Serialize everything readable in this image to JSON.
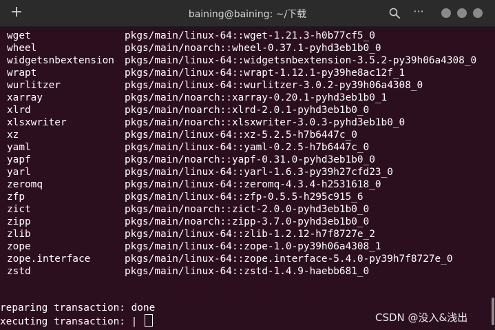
{
  "window": {
    "title": "baining@baining: ~/下载",
    "new_tab_glyph": "+",
    "menu_glyph": "···",
    "icons": [
      "new-tab-icon",
      "search-icon",
      "menu-icon",
      "minimize-icon",
      "maximize-icon",
      "close-icon"
    ]
  },
  "colors": {
    "terminal_bg": "#2c0f1f",
    "titlebar_bg": "#2b2b2b",
    "text": "#ffffff"
  },
  "packages": [
    {
      "name": "wget",
      "channel": "pkgs/main/linux-64::wget-1.21.3-h0b77cf5_0"
    },
    {
      "name": "wheel",
      "channel": "pkgs/main/noarch::wheel-0.37.1-pyhd3eb1b0_0"
    },
    {
      "name": "widgetsnbextension",
      "channel": "pkgs/main/linux-64::widgetsnbextension-3.5.2-py39h06a4308_0"
    },
    {
      "name": "wrapt",
      "channel": "pkgs/main/linux-64::wrapt-1.12.1-py39he8ac12f_1"
    },
    {
      "name": "wurlitzer",
      "channel": "pkgs/main/linux-64::wurlitzer-3.0.2-py39h06a4308_0"
    },
    {
      "name": "xarray",
      "channel": "pkgs/main/noarch::xarray-0.20.1-pyhd3eb1b0_1"
    },
    {
      "name": "xlrd",
      "channel": "pkgs/main/noarch::xlrd-2.0.1-pyhd3eb1b0_0"
    },
    {
      "name": "xlsxwriter",
      "channel": "pkgs/main/noarch::xlsxwriter-3.0.3-pyhd3eb1b0_0"
    },
    {
      "name": "xz",
      "channel": "pkgs/main/linux-64::xz-5.2.5-h7b6447c_0"
    },
    {
      "name": "yaml",
      "channel": "pkgs/main/linux-64::yaml-0.2.5-h7b6447c_0"
    },
    {
      "name": "yapf",
      "channel": "pkgs/main/noarch::yapf-0.31.0-pyhd3eb1b0_0"
    },
    {
      "name": "yarl",
      "channel": "pkgs/main/linux-64::yarl-1.6.3-py39h27cfd23_0"
    },
    {
      "name": "zeromq",
      "channel": "pkgs/main/linux-64::zeromq-4.3.4-h2531618_0"
    },
    {
      "name": "zfp",
      "channel": "pkgs/main/linux-64::zfp-0.5.5-h295c915_6"
    },
    {
      "name": "zict",
      "channel": "pkgs/main/noarch::zict-2.0.0-pyhd3eb1b0_0"
    },
    {
      "name": "zipp",
      "channel": "pkgs/main/noarch::zipp-3.7.0-pyhd3eb1b0_0"
    },
    {
      "name": "zlib",
      "channel": "pkgs/main/linux-64::zlib-1.2.12-h7f8727e_2"
    },
    {
      "name": "zope",
      "channel": "pkgs/main/linux-64::zope-1.0-py39h06a4308_1"
    },
    {
      "name": "zope.interface",
      "channel": "pkgs/main/linux-64::zope.interface-5.4.0-py39h7f8727e_0"
    },
    {
      "name": "zstd",
      "channel": "pkgs/main/linux-64::zstd-1.4.9-haebb681_0"
    }
  ],
  "status": {
    "preparing": "reparing transaction: done",
    "executing": "xecuting transaction: | "
  },
  "watermark": "CSDN @没入&浅出"
}
